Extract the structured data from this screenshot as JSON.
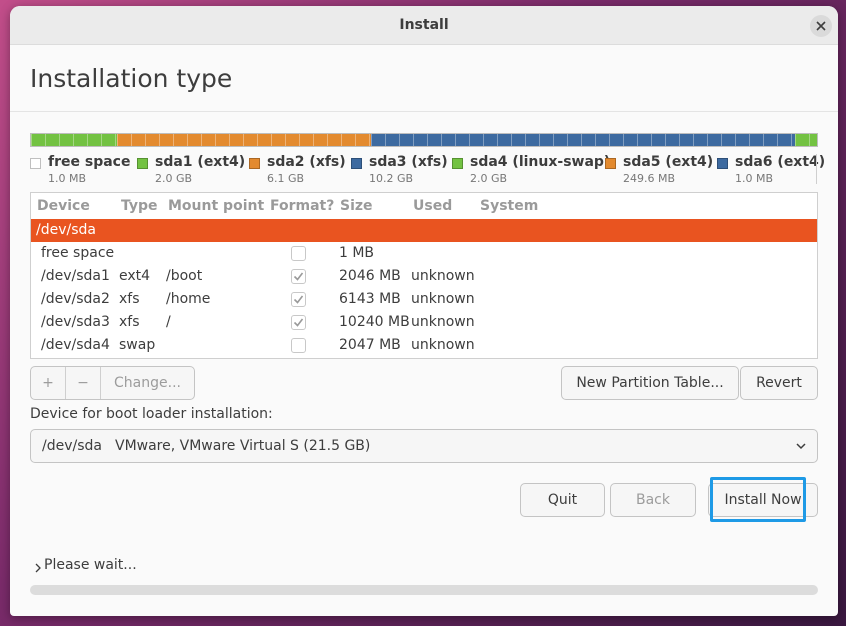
{
  "window": {
    "title": "Install",
    "page_title": "Installation type"
  },
  "partition_bar": [
    {
      "name": "free space",
      "color": "#ffffff",
      "fraction": 0.0001
    },
    {
      "name": "sda1 (ext4)",
      "color": "#73c242",
      "fraction": 0.1074
    },
    {
      "name": "sda2 (xfs)",
      "color": "#e38a2f",
      "fraction": 0.3196
    },
    {
      "name": "sda3 (xfs)",
      "color": "#3d6aa0",
      "fraction": 0.5328
    },
    {
      "name": "sda4 (linux-swap)",
      "color": "#73c242",
      "fraction": 0.0276
    }
  ],
  "legend": [
    {
      "name": "free space",
      "size": "1.0 MB",
      "color": "#ffffff"
    },
    {
      "name": "sda1 (ext4)",
      "size": "2.0 GB",
      "color": "#73c242"
    },
    {
      "name": "sda2 (xfs)",
      "size": "6.1 GB",
      "color": "#e38a2f"
    },
    {
      "name": "sda3 (xfs)",
      "size": "10.2 GB",
      "color": "#3d6aa0"
    },
    {
      "name": "sda4 (linux-swap)",
      "size": "2.0 GB",
      "color": "#73c242"
    },
    {
      "name": "sda5 (ext4)",
      "size": "249.6 MB",
      "color": "#e38a2f"
    },
    {
      "name": "sda6 (ext4)",
      "size": "1.0 MB",
      "color": "#3d6aa0"
    }
  ],
  "table": {
    "columns": [
      "Device",
      "Type",
      "Mount point",
      "Format?",
      "Size",
      "Used",
      "System"
    ],
    "rows": [
      {
        "device": "/dev/sda",
        "type": "",
        "mount": "",
        "format": null,
        "size": "",
        "used": "",
        "system": "",
        "selected": true
      },
      {
        "device": "free space",
        "type": "",
        "mount": "",
        "format": false,
        "size": "1 MB",
        "used": "",
        "system": ""
      },
      {
        "device": "/dev/sda1",
        "type": "ext4",
        "mount": "/boot",
        "format": true,
        "size": "2046 MB",
        "used": "unknown",
        "system": ""
      },
      {
        "device": "/dev/sda2",
        "type": "xfs",
        "mount": "/home",
        "format": true,
        "size": "6143 MB",
        "used": "unknown",
        "system": ""
      },
      {
        "device": "/dev/sda3",
        "type": "xfs",
        "mount": "/",
        "format": true,
        "size": "10240 MB",
        "used": "unknown",
        "system": ""
      },
      {
        "device": "/dev/sda4",
        "type": "swap",
        "mount": "",
        "format": false,
        "size": "2047 MB",
        "used": "unknown",
        "system": ""
      }
    ]
  },
  "toolbar": {
    "add_label": "+",
    "remove_label": "−",
    "change_label": "Change...",
    "new_table_label": "New Partition Table...",
    "revert_label": "Revert"
  },
  "boot": {
    "label": "Device for boot loader installation:",
    "device": "/dev/sda",
    "description": "VMware, VMware Virtual S (21.5 GB)"
  },
  "actions": {
    "quit_label": "Quit",
    "back_label": "Back",
    "install_label": "Install Now"
  },
  "status": {
    "text": "Please wait...",
    "progress": 0
  },
  "colors": {
    "accent": "#e95420",
    "focus": "#1e9ae6"
  }
}
